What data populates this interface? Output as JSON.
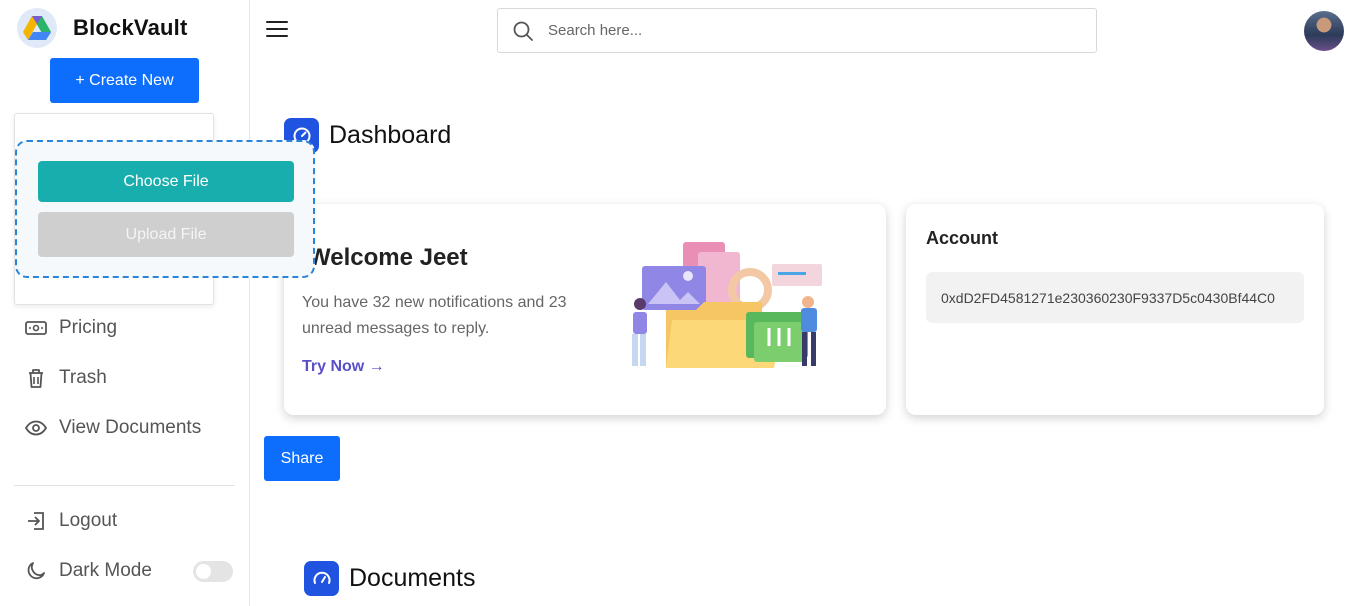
{
  "brand": {
    "name": "BlockVault",
    "logo_icon": "drive-logo-icon"
  },
  "sidebar": {
    "create_label": "+ Create New",
    "upload_popup": {
      "choose_label": "Choose File",
      "upload_label": "Upload File"
    },
    "items": [
      {
        "label": "Pricing",
        "icon": "cash-icon"
      },
      {
        "label": "Trash",
        "icon": "trash-icon"
      },
      {
        "label": "View Documents",
        "icon": "eye-icon"
      }
    ],
    "bottom": [
      {
        "label": "Logout",
        "icon": "logout-icon"
      },
      {
        "label": "Dark Mode",
        "icon": "moon-icon",
        "toggle_on": false
      }
    ]
  },
  "header": {
    "search_placeholder": "Search here..."
  },
  "dashboard": {
    "title": "Dashboard",
    "welcome": {
      "heading": "Welcome Jeet",
      "message": "You have 32 new notifications and 23 unread messages to reply.",
      "cta": "Try Now →"
    },
    "account": {
      "heading": "Account",
      "address": "0xdD2FD4581271e230360230F9337D5c0430Bf44C0"
    },
    "share_label": "Share"
  },
  "documents": {
    "title": "Documents"
  },
  "colors": {
    "primary": "#0d6efd",
    "teal": "#19aeae",
    "section_icon": "#1f53e0",
    "cta": "#5b4fc7"
  }
}
